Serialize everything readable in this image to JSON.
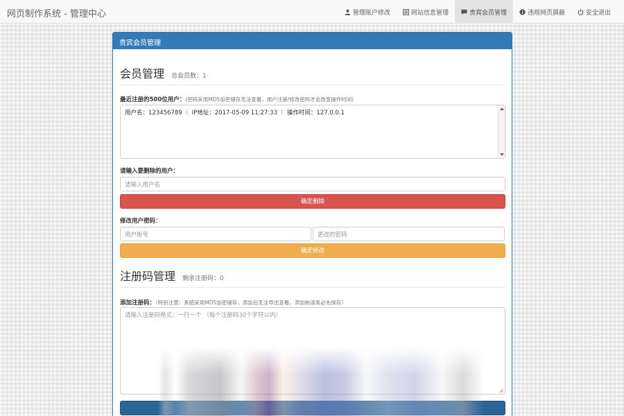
{
  "app": {
    "title": "网页制作系统 - 管理中心"
  },
  "nav": {
    "items": [
      {
        "label": "管理账户修改",
        "icon": "user-icon",
        "active": false
      },
      {
        "label": "网站信息管理",
        "icon": "list-icon",
        "active": false
      },
      {
        "label": "贵宾会员管理",
        "icon": "comment-icon",
        "active": true
      },
      {
        "label": "违规网页屏蔽",
        "icon": "info-icon",
        "active": false
      },
      {
        "label": "安全退出",
        "icon": "power-icon",
        "active": false
      }
    ]
  },
  "panel": {
    "heading": "贵宾会员管理"
  },
  "members": {
    "title": "会员管理",
    "count_label": "总会员数：1",
    "recent_label": "最近注册的500位用户：",
    "recent_note": "(密码采用MD5加密储存无法查看。用户注册/修改密码才会改变操作时间)",
    "recent_text": "用户名：123456789 ｜ IP地址：2017-05-09 11:27:33 ｜ 操作时间：127.0.0.1",
    "delete_label": "请输入要删除的用户：",
    "delete_placeholder": "请输入用户名",
    "delete_button": "确定删除",
    "change_label": "修改用户密码：",
    "account_placeholder": "用户账号",
    "password_placeholder": "更改的密码",
    "change_button": "确定修改"
  },
  "regcodes": {
    "title": "注册码管理",
    "remaining_label": "剩余注册码：0",
    "add_label": "添加注册码：",
    "add_note": "（特别注意：系统采用MD5加密储存，添加后无法导出查看，添加前请务必先保存）",
    "add_placeholder": "请输入注册码格式：一行一个 （每个注册码30个字符以内）"
  },
  "colors": {
    "primary": "#337ab7",
    "danger": "#d9534f",
    "warning": "#f0ad4e"
  }
}
